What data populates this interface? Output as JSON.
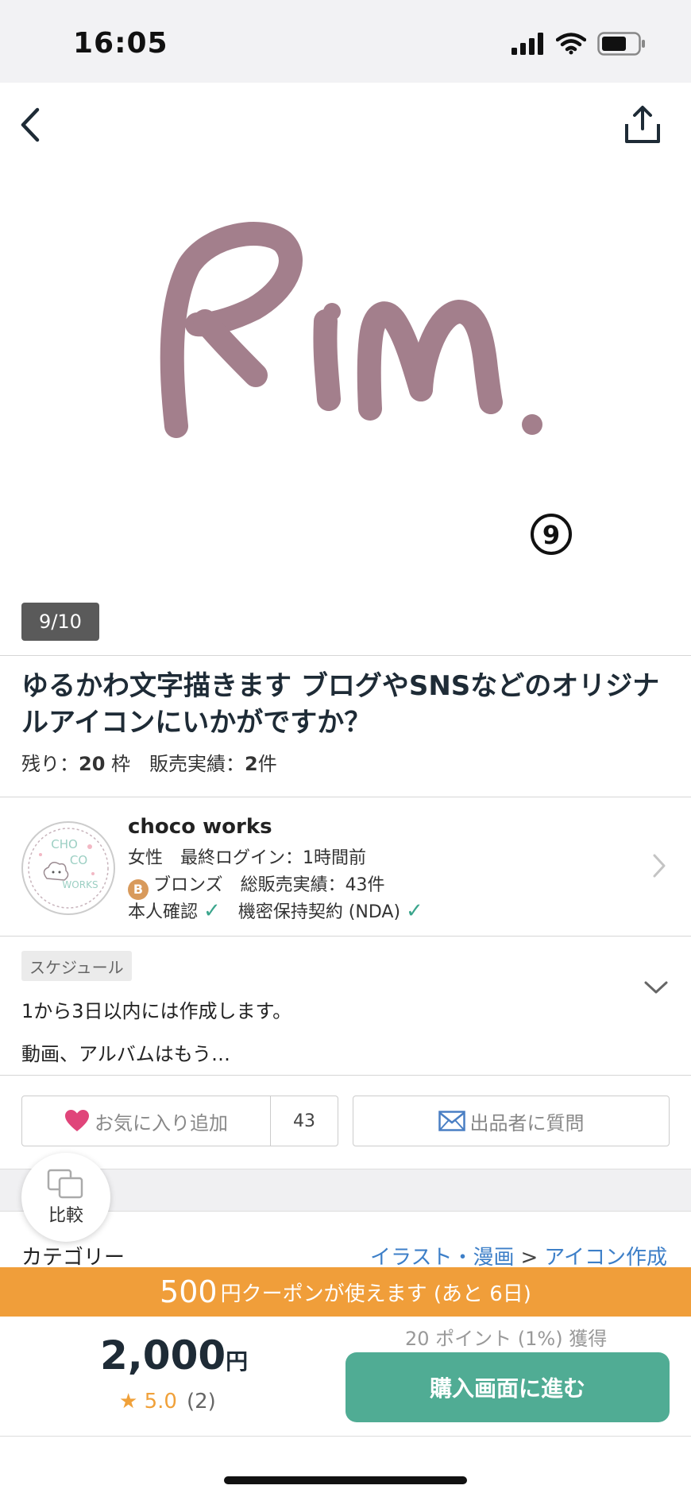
{
  "status_bar": {
    "time": "16:05"
  },
  "hero": {
    "image_text": "Rin.",
    "badge_number": "9",
    "counter": "9/10"
  },
  "listing": {
    "title": "ゆるかわ文字描きます ブログやSNSなどのオリジナルアイコンにいかがですか？",
    "remaining_label": "残り：",
    "remaining_value": "20",
    "remaining_unit": "枠",
    "sales_label": "販売実績：",
    "sales_value": "2",
    "sales_unit": "件"
  },
  "seller": {
    "avatar_text": [
      "CHO",
      "CO",
      "WORKS"
    ],
    "name": "choco works",
    "gender": "女性",
    "last_login": "最終ログイン：1時間前",
    "rank_badge": "B",
    "rank": "ブロンズ",
    "total_sales": "総販売実績：43件",
    "identity_verified": "本人確認",
    "nda": "機密保持契約 (NDA)"
  },
  "schedule": {
    "tag": "スケジュール",
    "line1": "1から3日以内には作成します。",
    "line2": "動画、アルバムはもう…"
  },
  "actions": {
    "favorite_label": "お気に入り追加",
    "favorite_count": "43",
    "ask_label": "出品者に質問"
  },
  "compare": {
    "label": "比較"
  },
  "category": {
    "label": "カテゴリー",
    "parent": "イラスト・漫画",
    "separator": ">",
    "child": "アイコン作成"
  },
  "coupon": {
    "amount": "500",
    "text": "円クーポンが使えます (あと 6日)"
  },
  "purchase": {
    "price": "2,000",
    "price_unit": "円",
    "rating_star": "★",
    "rating": "5.0",
    "review_count": "(2)",
    "points": "20 ポイント (1%) 獲得",
    "buy_label": "購入画面に進む"
  },
  "colors": {
    "accent_green": "#50ac94",
    "coupon_orange": "#f09e3a",
    "link_blue": "#3d7fc8",
    "heart_pink": "#e0457a",
    "art_mauve": "#a37f8c"
  }
}
